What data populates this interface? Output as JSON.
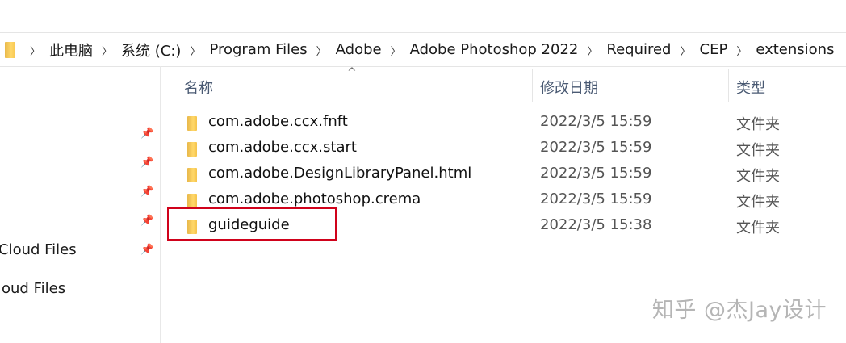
{
  "address": {
    "crumbs": [
      "此电脑",
      "系统 (C:)",
      "Program Files",
      "Adobe",
      "Adobe Photoshop 2022",
      "Required",
      "CEP",
      "extensions"
    ]
  },
  "columns": {
    "name": "名称",
    "date": "修改日期",
    "type": "类型"
  },
  "files": [
    {
      "name": "com.adobe.ccx.fnft",
      "date": "2022/3/5 15:59",
      "type": "文件夹"
    },
    {
      "name": "com.adobe.ccx.start",
      "date": "2022/3/5 15:59",
      "type": "文件夹"
    },
    {
      "name": "com.adobe.DesignLibraryPanel.html",
      "date": "2022/3/5 15:59",
      "type": "文件夹"
    },
    {
      "name": "com.adobe.photoshop.crema",
      "date": "2022/3/5 15:59",
      "type": "文件夹"
    },
    {
      "name": "guideguide",
      "date": "2022/3/5 15:38",
      "type": "文件夹"
    }
  ],
  "nav": {
    "items": [
      "Cloud Files",
      "oud Files"
    ]
  },
  "watermark": "知乎 @杰Jay设计"
}
